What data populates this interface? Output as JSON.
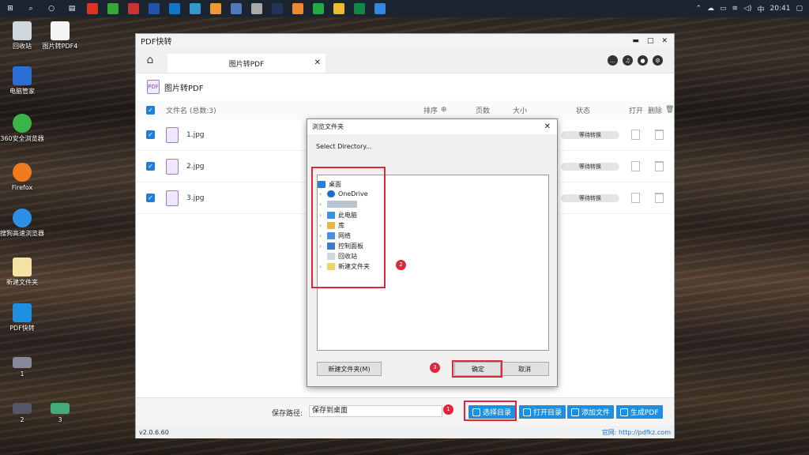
{
  "taskbar": {
    "clock": "20:41",
    "ime": "中"
  },
  "desktop": {
    "items": [
      "回收站",
      "图片转PDF4",
      "电脑管家",
      "360安全浏览器",
      "Firefox",
      "搜狗高速浏览器",
      "新建文件夹",
      "PDF快转",
      "1",
      "2",
      "3"
    ]
  },
  "app": {
    "title": "PDF快转",
    "tab_label": "图片转PDF",
    "heading": "图片转PDF",
    "columns": {
      "name": "文件名 (总数:3)",
      "sort": "排序",
      "pages": "页数",
      "size": "大小",
      "status": "状态",
      "open": "打开",
      "delete": "删除"
    },
    "files": [
      {
        "name": "1.jpg",
        "status": "等待转换"
      },
      {
        "name": "2.jpg",
        "status": "等待转换"
      },
      {
        "name": "3.jpg",
        "status": "等待转换"
      }
    ],
    "save_label": "保存路径:",
    "save_value": "保存到桌面",
    "buttons": {
      "choose_dir": "选择目录",
      "open_dir": "打开目录",
      "add_file": "添加文件",
      "gen_pdf": "生成PDF"
    },
    "version": "v2.0.6.60",
    "website": "官网: http://pdfkz.com"
  },
  "dialog": {
    "title": "浏览文件夹",
    "subtitle": "Select Directory...",
    "tree": [
      "桌面",
      "OneDrive",
      "此电脑",
      "库",
      "网络",
      "控制面板",
      "回收站",
      "新建文件夹"
    ],
    "new_folder": "新建文件夹(M)",
    "ok": "确定",
    "cancel": "取消"
  },
  "badges": [
    "1",
    "2",
    "3"
  ],
  "colors": {
    "accent": "#1d8fe0",
    "highlight": "#e0263a"
  }
}
